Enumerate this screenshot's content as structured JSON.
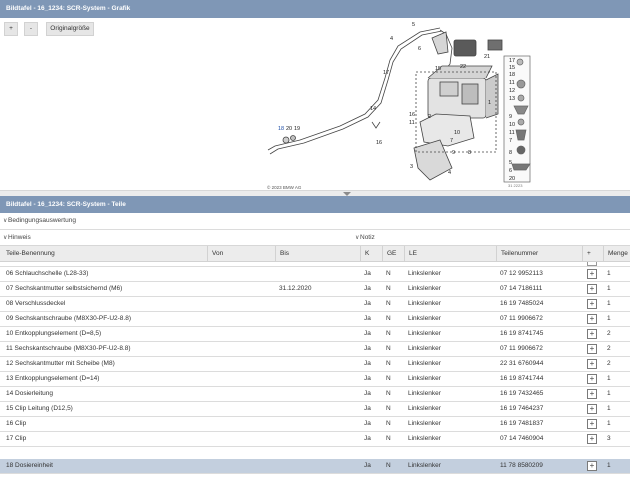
{
  "window": {
    "title_graphic": "Bildtafel - 16_1234: SCR-System - Grafik",
    "title_parts": "Bildtafel - 16_1234: SCR-System - Teile"
  },
  "toolbar": {
    "zoom_in_label": "+",
    "zoom_out_label": "-",
    "original_size_label": "Originalgröße"
  },
  "drawing": {
    "copyright": "© 2023 BMW AG",
    "image_id": "31 2223",
    "callouts": [
      "1",
      "2",
      "3",
      "4",
      "5",
      "6",
      "7",
      "8",
      "9",
      "10",
      "11",
      "12",
      "13",
      "14",
      "15",
      "16",
      "17",
      "18",
      "19",
      "20",
      "21",
      "22"
    ],
    "sidebar_numbers": [
      "17",
      "15",
      "18",
      "11",
      "12",
      "13",
      "9",
      "10",
      "11",
      "7",
      "8",
      "5",
      "6",
      "20"
    ]
  },
  "filters": {
    "conditions_label": "Bedingungsauswertung",
    "hint_label": "Hinweis",
    "note_label": "Notiz"
  },
  "table": {
    "headers": [
      "Teile-Benennung",
      "Von",
      "Bis",
      "K",
      "GE",
      "LE",
      "Teilenummer",
      "+",
      "Menge"
    ],
    "rows": [
      {
        "name": "06 Schlauchschelle (L28-33)",
        "von": "",
        "bis": "",
        "k": "Ja",
        "ge": "N",
        "le": "Linkslenker",
        "nr": "07 12 9952113",
        "qty": "1"
      },
      {
        "name": "07 Sechskantmutter selbstsichernd (M6)",
        "von": "",
        "bis": "31.12.2020",
        "k": "Ja",
        "ge": "N",
        "le": "Linkslenker",
        "nr": "07 14 7186111",
        "qty": "1"
      },
      {
        "name": "08 Verschlussdeckel",
        "von": "",
        "bis": "",
        "k": "Ja",
        "ge": "N",
        "le": "Linkslenker",
        "nr": "16 19 7485024",
        "qty": "1"
      },
      {
        "name": "09 Sechskantschraube (M8X30-PF-U2-8.8)",
        "von": "",
        "bis": "",
        "k": "Ja",
        "ge": "N",
        "le": "Linkslenker",
        "nr": "07 11 9906672",
        "qty": "1"
      },
      {
        "name": "10 Entkopplungselement (D=8,5)",
        "von": "",
        "bis": "",
        "k": "Ja",
        "ge": "N",
        "le": "Linkslenker",
        "nr": "16 19 8741745",
        "qty": "2"
      },
      {
        "name": "11 Sechskantschraube (M8X30-PF-U2-8.8)",
        "von": "",
        "bis": "",
        "k": "Ja",
        "ge": "N",
        "le": "Linkslenker",
        "nr": "07 11 9906672",
        "qty": "2"
      },
      {
        "name": "12 Sechskantmutter mit Scheibe (M8)",
        "von": "",
        "bis": "",
        "k": "Ja",
        "ge": "N",
        "le": "Linkslenker",
        "nr": "22 31 6760944",
        "qty": "2"
      },
      {
        "name": "13 Entkopplungselement (D=14)",
        "von": "",
        "bis": "",
        "k": "Ja",
        "ge": "N",
        "le": "Linkslenker",
        "nr": "16 19 8741744",
        "qty": "1"
      },
      {
        "name": "14 Dosierleitung",
        "von": "",
        "bis": "",
        "k": "Ja",
        "ge": "N",
        "le": "Linkslenker",
        "nr": "16 19 7432465",
        "qty": "1"
      },
      {
        "name": "15 Clip Leitung (D12,5)",
        "von": "",
        "bis": "",
        "k": "Ja",
        "ge": "N",
        "le": "Linkslenker",
        "nr": "16 19 7464237",
        "qty": "1"
      },
      {
        "name": "16 Clip",
        "von": "",
        "bis": "",
        "k": "Ja",
        "ge": "N",
        "le": "Linkslenker",
        "nr": "16 19 7481837",
        "qty": "1"
      },
      {
        "name": "17 Clip",
        "von": "",
        "bis": "",
        "k": "Ja",
        "ge": "N",
        "le": "Linkslenker",
        "nr": "07 14 7460904",
        "qty": "3"
      }
    ],
    "last_row": {
      "name": "18 Dosiereinheit",
      "von": "",
      "bis": "",
      "k": "Ja",
      "ge": "N",
      "le": "Linkslenker",
      "nr": "11 78 8580209",
      "qty": "1"
    },
    "add_icon": "add-to-cart-icon"
  }
}
